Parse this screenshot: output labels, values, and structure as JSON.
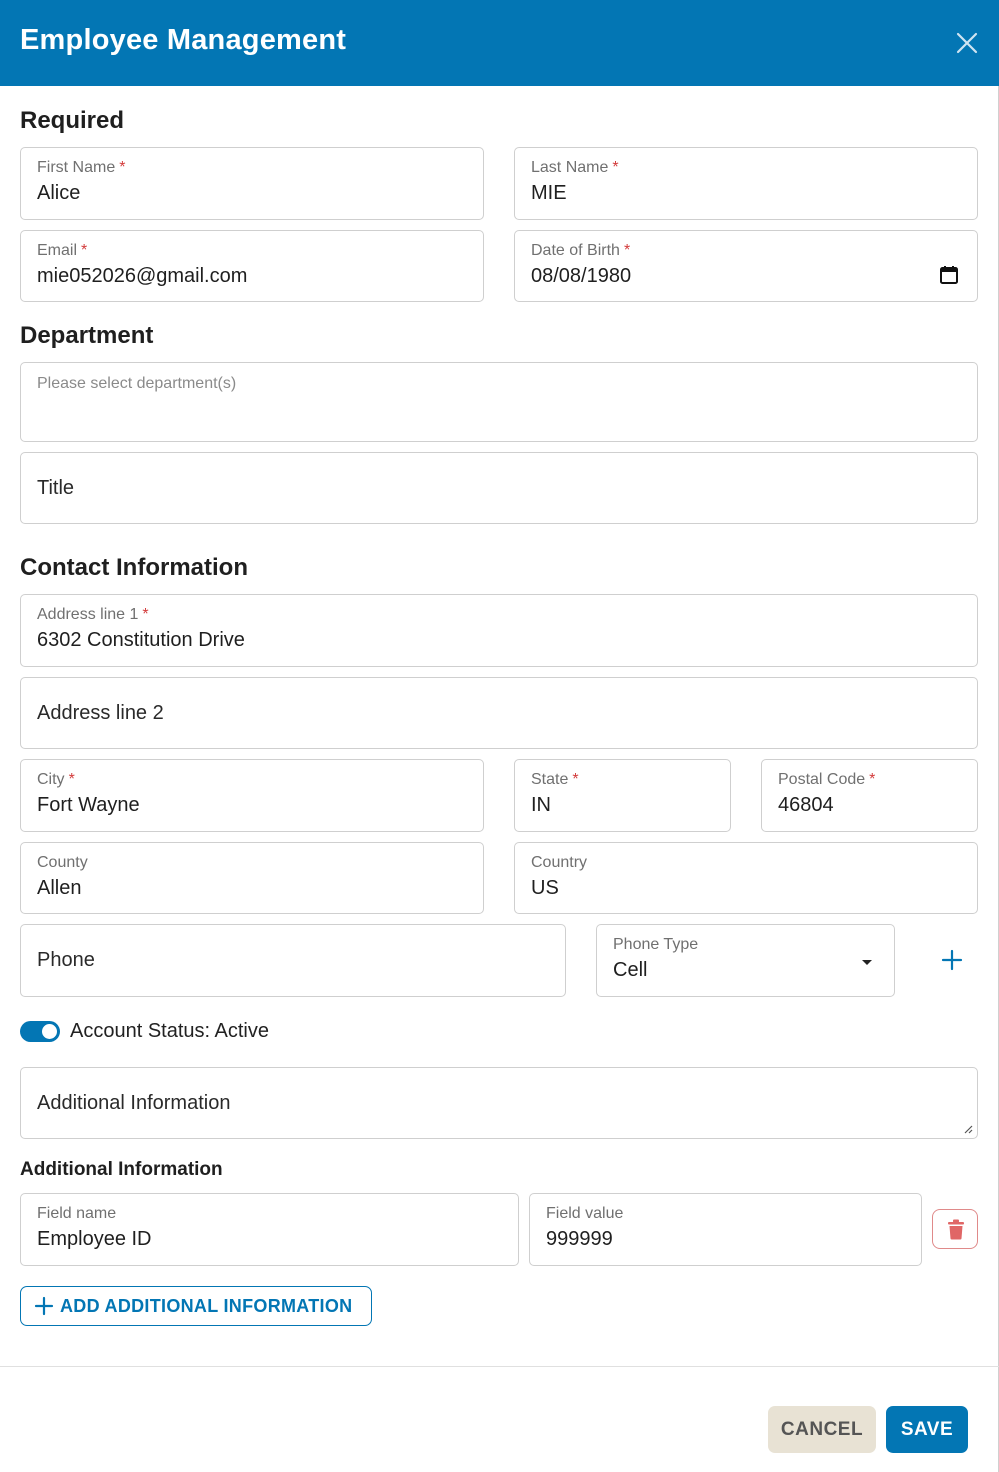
{
  "header": {
    "title": "Employee Management"
  },
  "sections": {
    "required": "Required",
    "department": "Department",
    "contact": "Contact Information",
    "additional": "Additional Information"
  },
  "fields": {
    "first_name": {
      "label": "First Name",
      "value": "Alice"
    },
    "last_name": {
      "label": "Last Name",
      "value": "MIE"
    },
    "email": {
      "label": "Email",
      "value": "mie052026@gmail.com"
    },
    "dob": {
      "label": "Date of Birth",
      "value": "08/08/1980"
    },
    "department": {
      "placeholder": "Please select department(s)"
    },
    "title": {
      "placeholder": "Title"
    },
    "address1": {
      "label": "Address line 1",
      "value": "6302 Constitution Drive"
    },
    "address2": {
      "placeholder": "Address line 2"
    },
    "city": {
      "label": "City",
      "value": "Fort Wayne"
    },
    "state": {
      "label": "State",
      "value": "IN"
    },
    "postal": {
      "label": "Postal Code",
      "value": "46804"
    },
    "county": {
      "label": "County",
      "value": "Allen"
    },
    "country": {
      "label": "Country",
      "value": "US"
    },
    "phone": {
      "placeholder": "Phone"
    },
    "phone_type": {
      "label": "Phone Type",
      "value": "Cell"
    },
    "additional_info": {
      "placeholder": "Additional Information"
    },
    "field_name": {
      "label": "Field name",
      "value": "Employee ID"
    },
    "field_value": {
      "label": "Field value",
      "value": "999999"
    }
  },
  "required_marker": "*",
  "account_status": {
    "label": "Account Status: Active",
    "enabled": true
  },
  "buttons": {
    "add_additional": "ADD ADDITIONAL INFORMATION",
    "cancel": "CANCEL",
    "save": "SAVE"
  },
  "colors": {
    "primary": "#0376b4",
    "required": "#d33b3b",
    "danger": "#e06666",
    "cancel_bg": "#e8e2d4"
  }
}
